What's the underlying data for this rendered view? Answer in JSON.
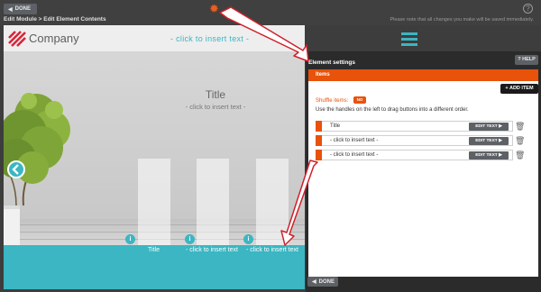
{
  "topbar": {
    "done_label": "DONE",
    "breadcrumb": "Edit Module > Edit Element Contents",
    "save_note": "Please note that all changes you make will be saved immediately.",
    "help_glyph": "?"
  },
  "preview": {
    "company_name": "Company",
    "header_placeholder": "- click to insert text -",
    "slide_title": "Title",
    "slide_subtitle": "- click to insert text -",
    "info_glyph": "i",
    "tabs": [
      {
        "label": "Title"
      },
      {
        "label": "- click to insert text"
      },
      {
        "label": "- click to insert text"
      }
    ]
  },
  "panel": {
    "title": "Element settings",
    "help_label": "HELP",
    "help_glyph": "?",
    "items_tab": "Items",
    "add_item_label": "ADD ITEM",
    "add_glyph": "+",
    "shuffle_label": "Shuffle items:",
    "shuffle_value": "NO",
    "hint": "Use the handles on the left to drag buttons into a different order.",
    "edit_label": "EDIT TEXT",
    "items": [
      {
        "label": "Title"
      },
      {
        "label": "- click to insert text -"
      },
      {
        "label": "- click to insert text -"
      }
    ],
    "done_label": "DONE"
  },
  "colors": {
    "accent_orange": "#e8520a",
    "teal": "#3bb6c2",
    "dark_bg": "#2b2b2b",
    "annotation_red": "#d0202a"
  },
  "icons": [
    "gear-icon",
    "help-icon",
    "company-logo",
    "hamburger-icon",
    "chevron-left-icon",
    "info-icon",
    "plus-icon",
    "trash-icon",
    "play-icon"
  ]
}
